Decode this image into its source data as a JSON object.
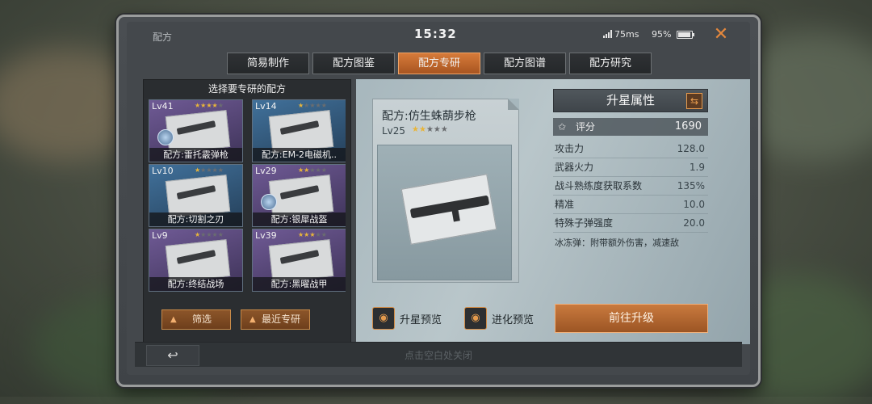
{
  "status": {
    "screen_label": "配方",
    "time": "15:32",
    "ping": "75ms",
    "battery": "95%",
    "battery_level": 0.95
  },
  "tabs": [
    {
      "label": "简易制作",
      "active": false
    },
    {
      "label": "配方图鉴",
      "active": false
    },
    {
      "label": "配方专研",
      "active": true
    },
    {
      "label": "配方图谱",
      "active": false
    },
    {
      "label": "配方研究",
      "active": false
    }
  ],
  "list": {
    "header": "选择要专研的配方",
    "cards": [
      {
        "level": "Lv41",
        "name": "配方:雷托霰弹枪",
        "stars_on": 4,
        "stars_total": 5,
        "rarity": "purple",
        "badge": true
      },
      {
        "level": "Lv14",
        "name": "配方:EM-2电磁机..",
        "stars_on": 1,
        "stars_total": 5,
        "rarity": "blue",
        "badge": false
      },
      {
        "level": "Lv10",
        "name": "配方:切割之刃",
        "stars_on": 1,
        "stars_total": 5,
        "rarity": "blue",
        "badge": false
      },
      {
        "level": "Lv29",
        "name": "配方:银犀战盔",
        "stars_on": 2,
        "stars_total": 5,
        "rarity": "purple",
        "badge": true
      },
      {
        "level": "Lv9",
        "name": "配方:终结战场",
        "stars_on": 1,
        "stars_total": 5,
        "rarity": "purple",
        "badge": false
      },
      {
        "level": "Lv39",
        "name": "配方:黑曜战甲",
        "stars_on": 3,
        "stars_total": 5,
        "rarity": "purple",
        "badge": false
      }
    ],
    "filter_button": "筛选",
    "recent_button": "最近专研"
  },
  "detail": {
    "title": "配方:仿生蛛蓢步枪",
    "level": "Lv25",
    "stars_on": 2,
    "stars_total": 5,
    "attr_header": "升星属性",
    "score_label": "评分",
    "score_value": "1690",
    "attributes": [
      {
        "label": "攻击力",
        "value": "128.0"
      },
      {
        "label": "武器火力",
        "value": "1.9"
      },
      {
        "label": "战斗熟练度获取系数",
        "value": "135%"
      },
      {
        "label": "精准",
        "value": "10.0"
      },
      {
        "label": "特殊子弹强度",
        "value": "20.0"
      }
    ],
    "note": "冰冻弹：附带额外伤害，减速敌",
    "star_preview": "升星预览",
    "evolve_preview": "进化预览",
    "upgrade_button": "前往升级"
  },
  "footer": {
    "hint": "点击空白处关闭"
  },
  "colors": {
    "accent": "#d77b3a",
    "star": "#e8b53a"
  }
}
